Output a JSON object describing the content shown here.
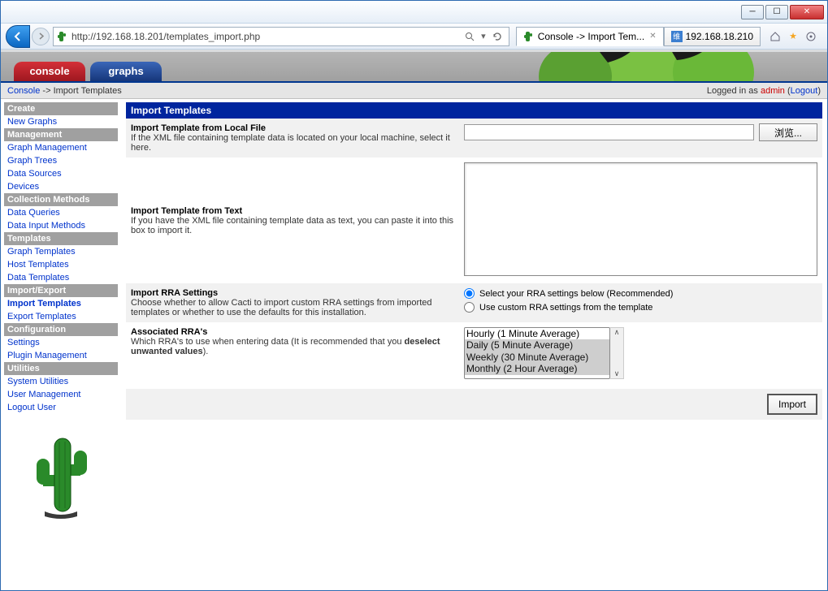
{
  "browser": {
    "url": "http://192.168.18.201/templates_import.php",
    "tab1_title": "Console -> Import Tem...",
    "tab2_title": "192.168.18.210"
  },
  "topTabs": {
    "console": "console",
    "graphs": "graphs"
  },
  "breadcrumb": {
    "console": "Console",
    "sep": " -> ",
    "page": "Import Templates"
  },
  "login": {
    "prefix": "Logged in as ",
    "user": "admin",
    "logout": "Logout"
  },
  "nav": {
    "create_h": "Create",
    "new_graphs": "New Graphs",
    "management_h": "Management",
    "graph_management": "Graph Management",
    "graph_trees": "Graph Trees",
    "data_sources": "Data Sources",
    "devices": "Devices",
    "collection_h": "Collection Methods",
    "data_queries": "Data Queries",
    "data_input": "Data Input Methods",
    "templates_h": "Templates",
    "graph_templates": "Graph Templates",
    "host_templates": "Host Templates",
    "data_templates": "Data Templates",
    "impexp_h": "Import/Export",
    "import_templates": "Import Templates",
    "export_templates": "Export Templates",
    "config_h": "Configuration",
    "settings": "Settings",
    "plugin_mgmt": "Plugin Management",
    "utilities_h": "Utilities",
    "system_util": "System Utilities",
    "user_mgmt": "User Management",
    "logout_user": "Logout User"
  },
  "panel": {
    "title": "Import Templates",
    "r1_label": "Import Template from Local File",
    "r1_desc": "If the XML file containing template data is located on your local machine, select it here.",
    "browse": "浏览...",
    "r2_label": "Import Template from Text",
    "r2_desc": "If you have the XML file containing template data as text, you can paste it into this box to import it.",
    "r3_label": "Import RRA Settings",
    "r3_desc": "Choose whether to allow Cacti to import custom RRA settings from imported templates or whether to use the defaults for this installation.",
    "r3_opt1": "Select your RRA settings below (Recommended)",
    "r3_opt2": "Use custom RRA settings from the template",
    "r4_label": "Associated RRA's",
    "r4_desc_a": "Which RRA's to use when entering data (It is recommended that you ",
    "r4_desc_b": "deselect unwanted values",
    "r4_desc_c": ").",
    "rra_hourly": "Hourly (1 Minute Average)",
    "rra_daily": "Daily (5 Minute Average)",
    "rra_weekly": "Weekly (30 Minute Average)",
    "rra_monthly": "Monthly (2 Hour Average)",
    "import_btn": "Import"
  }
}
